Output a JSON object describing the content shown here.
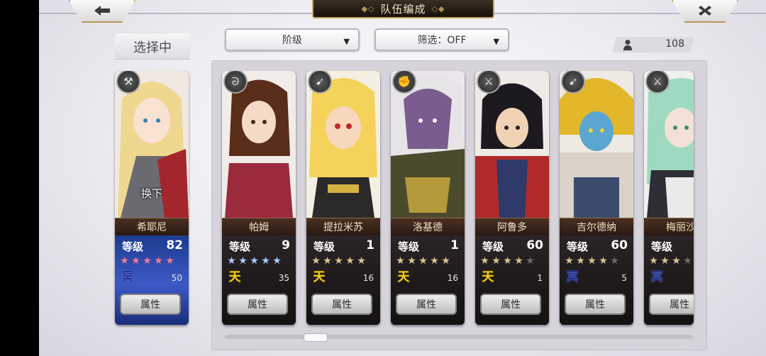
{
  "header": {
    "title": "队伍编成"
  },
  "selecting_label": "选择中",
  "dropdowns": {
    "rank": {
      "value": "阶级"
    },
    "filter": {
      "value": "筛选：OFF"
    }
  },
  "count": {
    "icon": "person-icon",
    "value": "108"
  },
  "selected": {
    "name": "希耶尼",
    "level_label": "等级",
    "level": "82",
    "stars": 5,
    "star_color": "#f07a92",
    "rank_mark": "冥",
    "rank_color": "#1e2f9e",
    "value": "50",
    "attr_label": "属性",
    "swap_label": "换下",
    "weapon": "axe-icon"
  },
  "cards": [
    {
      "name": "帕姆",
      "level_label": "等级",
      "level": "9",
      "stars": 5,
      "star_color": "#a9c8ff",
      "rank_mark": "天",
      "rank_color": "#f5d21a",
      "value": "35",
      "attr_label": "属性",
      "weapon": "whip-icon"
    },
    {
      "name": "提拉米苏",
      "level_label": "等级",
      "level": "1",
      "stars": 5,
      "star_color": "#d8c690",
      "rank_mark": "天",
      "rank_color": "#f5d21a",
      "value": "16",
      "attr_label": "属性",
      "weapon": "spear-icon"
    },
    {
      "name": "洛基德",
      "level_label": "等级",
      "level": "1",
      "stars": 5,
      "star_color": "#d8c690",
      "rank_mark": "天",
      "rank_color": "#f5d21a",
      "value": "16",
      "attr_label": "属性",
      "weapon": "fist-icon"
    },
    {
      "name": "阿鲁多",
      "level_label": "等级",
      "level": "60",
      "stars": 4,
      "star_color": "#d8c690",
      "rank_mark": "天",
      "rank_color": "#f5d21a",
      "value": "1",
      "attr_label": "属性",
      "weapon": "sword-icon"
    },
    {
      "name": "吉尔德纳",
      "level_label": "等级",
      "level": "60",
      "stars": 4,
      "star_color": "#d8c690",
      "rank_mark": "冥",
      "rank_color": "#1e2f9e",
      "value": "5",
      "attr_label": "属性",
      "weapon": "spear-icon"
    },
    {
      "name": "梅丽沙",
      "level_label": "等级",
      "level": "",
      "stars": 3,
      "star_color": "#d8c690",
      "rank_mark": "冥",
      "rank_color": "#1e2f9e",
      "value": "",
      "attr_label": "属性",
      "weapon": "sword-icon"
    }
  ],
  "colors": {
    "accent_gold": "#c2a261",
    "title_bg": "#231a12"
  }
}
